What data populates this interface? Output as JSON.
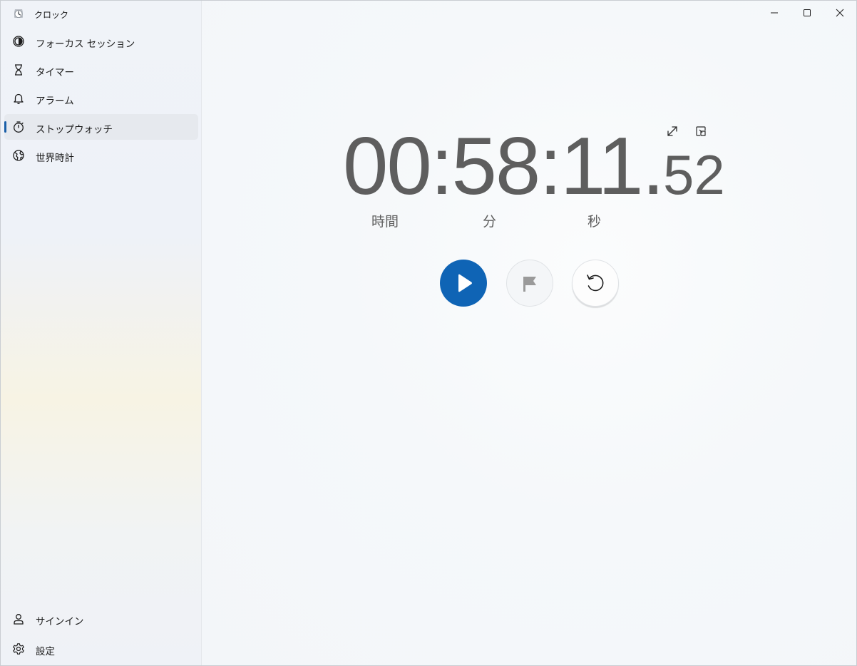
{
  "app": {
    "title": "クロック"
  },
  "nav": {
    "items": [
      {
        "label": "フォーカス セッション",
        "icon": "focus-session-icon"
      },
      {
        "label": "タイマー",
        "icon": "hourglass-icon"
      },
      {
        "label": "アラーム",
        "icon": "bell-icon"
      },
      {
        "label": "ストップウォッチ",
        "icon": "stopwatch-icon",
        "selected": true
      },
      {
        "label": "世界時計",
        "icon": "globe-icon"
      }
    ],
    "footer": [
      {
        "label": "サインイン",
        "icon": "person-icon"
      },
      {
        "label": "設定",
        "icon": "gear-icon"
      }
    ]
  },
  "stopwatch": {
    "hours": "00",
    "minutes": "58",
    "seconds": "11",
    "hundredths": "52",
    "sep_colon": ":",
    "sep_dot": ".",
    "unit_hours": "時間",
    "unit_minutes": "分",
    "unit_seconds": "秒"
  },
  "colors": {
    "accent": "#0f64b5",
    "selection_bar": "#1a5fa8",
    "digits": "#5e5e5e"
  }
}
